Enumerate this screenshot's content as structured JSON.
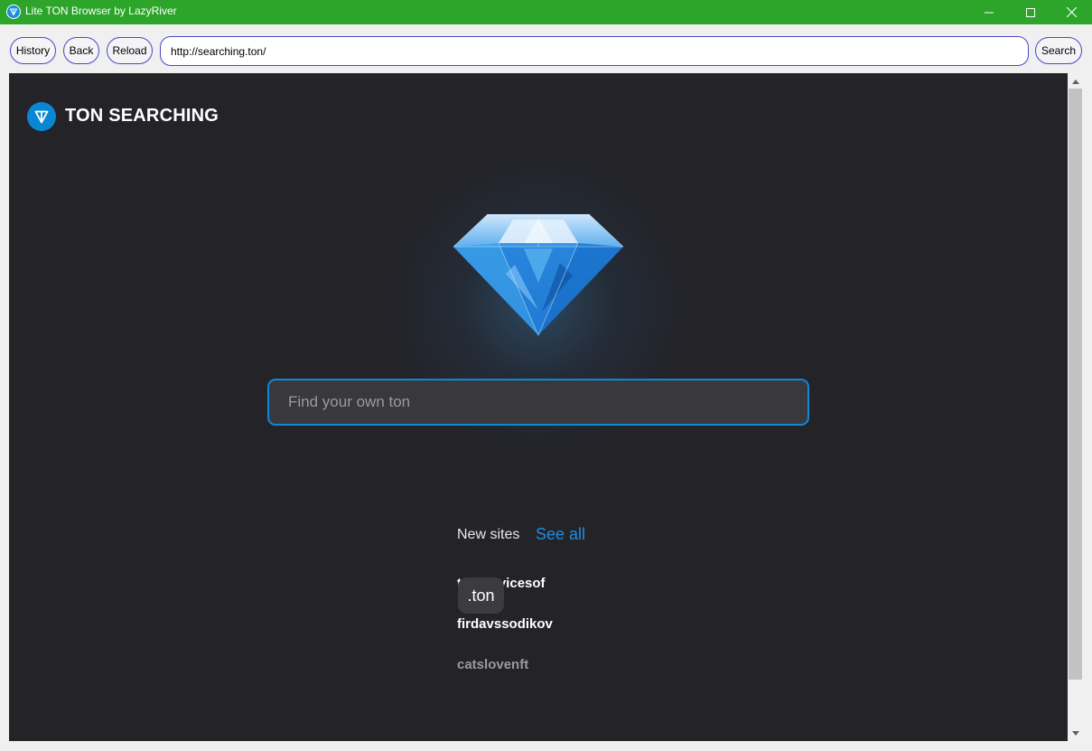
{
  "window": {
    "title": "Lite TON Browser by LazyRiver",
    "accent_color": "#2ca52a"
  },
  "toolbar": {
    "history_label": "History",
    "back_label": "Back",
    "reload_label": "Reload",
    "url": "http://searching.ton/",
    "search_label": "Search"
  },
  "page": {
    "site_title": "TON SEARCHING",
    "search_placeholder": "Find your own ton",
    "new_sites_label": "New sites",
    "see_all_label": "See all",
    "sites": [
      {
        "name": "tonservicesof"
      },
      {
        "name": "firdavssodikov"
      },
      {
        "name": "catslovenft"
      }
    ],
    "tooltip": ".ton",
    "colors": {
      "background": "#232328",
      "link": "#1f8de0",
      "search_border": "#0a8ad6"
    }
  }
}
